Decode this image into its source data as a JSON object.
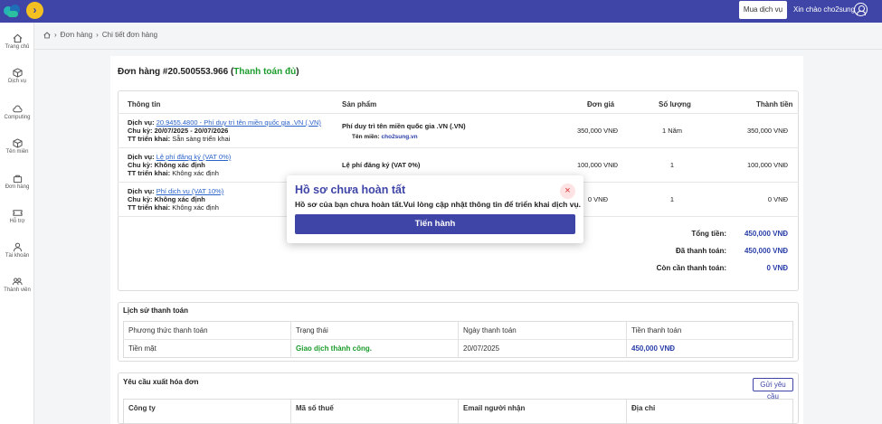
{
  "header": {
    "buy_label": "Mua dịch vụ",
    "greeting": "Xin chào cho2sung"
  },
  "sidebar": {
    "items": [
      {
        "label": "Trang chủ",
        "icon": "home-icon"
      },
      {
        "label": "Dịch vụ",
        "icon": "cube-icon"
      },
      {
        "label": "Computing",
        "icon": "cloud-icon"
      },
      {
        "label": "Tên miền",
        "icon": "box-icon"
      },
      {
        "label": "Đơn hàng",
        "icon": "bag-icon"
      },
      {
        "label": "Hỗ trợ",
        "icon": "ticket-icon"
      },
      {
        "label": "Tài khoản",
        "icon": "person-icon"
      },
      {
        "label": "Thành viên",
        "icon": "group-icon"
      }
    ]
  },
  "breadcrumb": {
    "items": [
      "Đơn hàng",
      "Chi tiết đơn hàng"
    ]
  },
  "order": {
    "title_prefix": "Đơn hàng #20.500553.966 (",
    "status": "Thanh toán đủ",
    "title_suffix": ")",
    "columns": [
      "Thông tin",
      "Sản phẩm",
      "Đơn giá",
      "Số lượng",
      "Thành tiền"
    ],
    "rows": [
      {
        "service_label": "Dịch vụ:",
        "service_link": "20.9455.4800 - Phí duy trì tên miền quốc gia .VN (.VN)",
        "cycle_label": "Chu kỳ:",
        "cycle": "20/07/2025 - 20/07/2026",
        "deploy_label": "TT triển khai:",
        "deploy": "Sẵn sàng triển khai",
        "product": "Phí duy trì tên miền quốc gia .VN (.VN)",
        "domain_label": "Tên miền:",
        "domain": "cho2sung.vn",
        "price": "350,000 VNĐ",
        "qty": "1 Năm",
        "total": "350,000 VNĐ"
      },
      {
        "service_label": "Dịch vụ:",
        "service_link": "Lệ phí đăng ký (VAT 0%)",
        "cycle_label": "Chu kỳ:",
        "cycle": "Không xác định",
        "deploy_label": "TT triển khai:",
        "deploy": "Không xác định",
        "product": "Lệ phí đăng ký (VAT 0%)",
        "price": "100,000 VNĐ",
        "qty": "1",
        "total": "100,000 VNĐ"
      },
      {
        "service_label": "Dịch vụ:",
        "service_link": "Phí dịch vụ (VAT 10%)",
        "cycle_label": "Chu kỳ:",
        "cycle": "Không xác định",
        "deploy_label": "TT triển khai:",
        "deploy": "Không xác định",
        "price": "0 VNĐ",
        "qty": "1",
        "total": "0 VNĐ"
      }
    ],
    "summary": [
      {
        "label": "Tổng tiền:",
        "value": "450,000 VNĐ"
      },
      {
        "label": "Đã thanh toán:",
        "value": "450,000 VNĐ"
      },
      {
        "label": "Còn cần thanh toán:",
        "value": "0 VNĐ"
      }
    ]
  },
  "payment_history": {
    "title": "Lịch sử thanh toán",
    "columns": [
      "Phương thức thanh toán",
      "Trạng thái",
      "Ngày thanh toán",
      "Tiền thanh toán"
    ],
    "row": {
      "method": "Tiền mặt",
      "status": "Giao dịch thành công.",
      "date": "20/07/2025",
      "amount": "450,000 VNĐ"
    }
  },
  "invoice": {
    "title": "Yêu cầu xuất hóa đơn",
    "button": "Gửi yêu cầu",
    "columns": [
      "Công ty",
      "Mã số thuế",
      "Email người nhận",
      "Địa chỉ"
    ]
  },
  "modal": {
    "title": "Hồ sơ chưa hoàn tất",
    "message": "Hồ sơ của bạn chưa hoàn tất.Vui lòng cập nhật thông tin để triển khai dịch vụ.",
    "button": "Tiến hành"
  },
  "colors": {
    "primary": "#3f45a6",
    "success": "#1a9b2a",
    "accent": "#f2c020"
  }
}
